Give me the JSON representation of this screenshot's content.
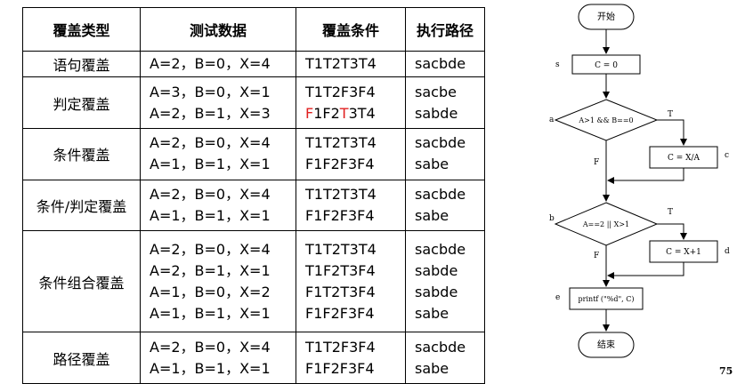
{
  "table": {
    "headers": [
      "覆盖类型",
      "测试数据",
      "覆盖条件",
      "执行路径"
    ],
    "rows": [
      {
        "type": "语句覆盖",
        "cases": [
          {
            "data": "A=2，B=0，X=4",
            "cond": "T1T2T3T4",
            "path": "sacbde"
          }
        ]
      },
      {
        "type": "判定覆盖",
        "cases": [
          {
            "data": "A=3，B=0，X=1",
            "cond": "T1T2F3F4",
            "path": "sacbe"
          },
          {
            "data": "A=2，B=1，X=3",
            "cond": "F1F2T3T4",
            "path": "sabde"
          }
        ]
      },
      {
        "type": "条件覆盖",
        "cases": [
          {
            "data": "A=2，B=0，X=4",
            "cond": "T1T2T3T4",
            "path": "sacbde"
          },
          {
            "data": "A=1，B=1，X=1",
            "cond": "F1F2F3F4",
            "path": "sabe"
          }
        ]
      },
      {
        "type": "条件/判定覆盖",
        "cases": [
          {
            "data": "A=2，B=0，X=4",
            "cond": "T1T2T3T4",
            "path": "sacbde"
          },
          {
            "data": "A=1，B=1，X=1",
            "cond": "F1F2F3F4",
            "path": "sabe"
          }
        ]
      },
      {
        "type": "条件组合覆盖",
        "cases": [
          {
            "data": "A=2，B=0，X=4",
            "cond": "T1T2T3T4",
            "path": "sacbde"
          },
          {
            "data": "A=2，B=1，X=1",
            "cond": "T1F2T3F4",
            "path": "sabde"
          },
          {
            "data": "A=1，B=0，X=2",
            "cond": "F1T2T3F4",
            "path": "sabde"
          },
          {
            "data": "A=1，B=1，X=1",
            "cond": "F1F2F3F4",
            "path": "sabe"
          }
        ]
      },
      {
        "type": "路径覆盖",
        "cases": [
          {
            "data": "A=2，B=0，X=4",
            "cond": "T1T2F3F4",
            "path": "sacbde"
          },
          {
            "data": "A=1，B=1，X=1",
            "cond": "F1F2F3F4",
            "path": "sabe"
          }
        ]
      }
    ],
    "highlight": {
      "row": 1,
      "case": 1,
      "red_chars": [
        0,
        4
      ],
      "color": "#e02020"
    }
  },
  "flowchart": {
    "start": "开始",
    "end": "结束",
    "node_s": "C = 0",
    "label_s": "s",
    "decision_a": "A>1 && B==0",
    "label_a": "a",
    "node_c": "C = X/A",
    "label_c": "c",
    "decision_b": "A==2 || X>1",
    "label_b": "b",
    "node_d": "C = X+1",
    "label_d": "d",
    "node_e": "printf (\"%d\", C)",
    "label_e": "e",
    "true_label": "T",
    "false_label": "F"
  },
  "page_number": "75"
}
